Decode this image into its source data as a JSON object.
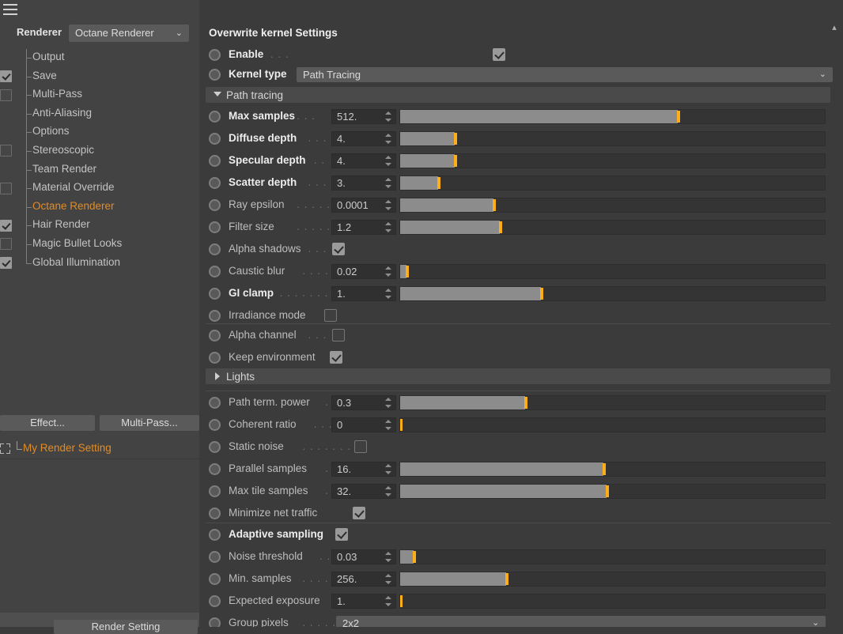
{
  "window": {
    "menu_icon": "hamburger-icon",
    "scroll_up_icon": "chevron-up-icon"
  },
  "sidebar": {
    "renderer_label": "Renderer",
    "renderer_value": "Octane Renderer",
    "renderer_chevron": "⌄",
    "tree_items": [
      {
        "label": "Output",
        "checkbox": "none",
        "selected": false
      },
      {
        "label": "Save",
        "checkbox": "on",
        "selected": false
      },
      {
        "label": "Multi-Pass",
        "checkbox": "off",
        "selected": false
      },
      {
        "label": "Anti-Aliasing",
        "checkbox": "none",
        "selected": false
      },
      {
        "label": "Options",
        "checkbox": "none",
        "selected": false
      },
      {
        "label": "Stereoscopic",
        "checkbox": "off",
        "selected": false
      },
      {
        "label": "Team Render",
        "checkbox": "none",
        "selected": false
      },
      {
        "label": "Material Override",
        "checkbox": "off",
        "selected": false
      },
      {
        "label": "Octane Renderer",
        "checkbox": "none",
        "selected": true
      },
      {
        "label": "Hair Render",
        "checkbox": "on",
        "selected": false
      },
      {
        "label": "Magic Bullet Looks",
        "checkbox": "off",
        "selected": false
      },
      {
        "label": "Global Illumination",
        "checkbox": "on",
        "selected": false
      }
    ],
    "effect_button": "Effect...",
    "multipass_button": "Multi-Pass...",
    "render_setting_name": "My Render Setting",
    "render_setting_button": "Render Setting"
  },
  "main": {
    "title": "Overwrite kernel Settings",
    "enable": {
      "label": "Enable",
      "dots": ". . .",
      "checked": true
    },
    "kernel_type": {
      "label": "Kernel type",
      "value": "Path Tracing",
      "chevron": "⌄"
    },
    "group_path_tracing": {
      "label": "Path tracing",
      "expanded": true
    },
    "group_lights": {
      "label": "Lights",
      "expanded": false
    },
    "rows": [
      {
        "label": "Max samples",
        "dots": ". . .",
        "bold": true,
        "type": "number",
        "value": "512.",
        "fill_pct": 65.4,
        "section": 1
      },
      {
        "label": "Diffuse depth",
        "dots": ". . .",
        "bold": true,
        "type": "number",
        "value": "4.",
        "fill_pct": 12.9,
        "section": 1
      },
      {
        "label": "Specular depth",
        "dots": ". .",
        "bold": true,
        "type": "number",
        "value": "4.",
        "fill_pct": 12.9,
        "section": 1
      },
      {
        "label": "Scatter depth",
        "dots": ". . .",
        "bold": true,
        "type": "number",
        "value": "3.",
        "fill_pct": 9.0,
        "section": 1
      },
      {
        "label": "Ray epsilon",
        "dots": ". . . . .",
        "bold": false,
        "type": "number",
        "value": "0.0001",
        "fill_pct": 21.9,
        "section": 1
      },
      {
        "label": "Filter size",
        "dots": ". . . . . . .",
        "bold": false,
        "type": "number",
        "value": "1.2",
        "fill_pct": 23.5,
        "section": 1
      },
      {
        "label": "Alpha shadows",
        "dots": ". . .",
        "bold": false,
        "type": "check",
        "value": true,
        "section": 1
      },
      {
        "label": "Caustic blur",
        "dots": ". . . . .",
        "bold": false,
        "type": "number",
        "value": "0.02",
        "fill_pct": 1.4,
        "section": 1
      },
      {
        "label": "GI clamp",
        "dots": ". . . . . . .",
        "bold": true,
        "type": "number",
        "value": "1.",
        "fill_pct": 33.1,
        "section": 1
      },
      {
        "label": "Irradiance mode",
        "dots": "",
        "bold": false,
        "type": "check",
        "value": false,
        "section": 1
      },
      {
        "label": "Alpha channel",
        "dots": ". . .",
        "bold": false,
        "type": "check",
        "value": false,
        "section": 2
      },
      {
        "label": "Keep environment",
        "dots": "",
        "bold": false,
        "type": "check",
        "value": true,
        "section": 2
      },
      {
        "label": "Path term. power",
        "dots": ". .",
        "bold": false,
        "type": "number",
        "value": "0.3",
        "fill_pct": 29.4,
        "section": 3
      },
      {
        "label": "Coherent ratio",
        "dots": ". . . .",
        "bold": false,
        "type": "number",
        "value": "0",
        "fill_pct": 0.0,
        "section": 3
      },
      {
        "label": "Static noise",
        "dots": ". . . . . . .",
        "bold": false,
        "type": "check",
        "value": false,
        "section": 3
      },
      {
        "label": "Parallel samples",
        "dots": ". . .",
        "bold": false,
        "type": "number",
        "value": "16.",
        "fill_pct": 47.8,
        "section": 3
      },
      {
        "label": "Max tile samples",
        "dots": ". .",
        "bold": false,
        "type": "number",
        "value": "32.",
        "fill_pct": 48.6,
        "section": 3
      },
      {
        "label": "Minimize net traffic",
        "dots": "",
        "bold": false,
        "type": "check",
        "value": true,
        "section": 3
      },
      {
        "label": "Adaptive sampling",
        "dots": "",
        "bold": true,
        "type": "check",
        "value": true,
        "section": 4
      },
      {
        "label": "Noise threshold",
        "dots": ". . . .",
        "bold": false,
        "type": "number",
        "value": "0.03",
        "fill_pct": 3.2,
        "section": 4
      },
      {
        "label": "Min. samples",
        "dots": ". . . . . .",
        "bold": false,
        "type": "number",
        "value": "256.",
        "fill_pct": 24.9,
        "section": 4
      },
      {
        "label": "Expected exposure",
        "dots": "",
        "bold": false,
        "type": "number",
        "value": "1.",
        "fill_pct": 0.0,
        "section": 4
      },
      {
        "label": "Group pixels",
        "dots": ". . . . . .",
        "bold": false,
        "type": "combo",
        "value": "2x2",
        "chevron": "⌄",
        "section": 4
      }
    ]
  },
  "colors": {
    "accent": "#e08c28",
    "slider_handle": "#ffae1a",
    "panel_bg": "#3b3b3b",
    "sidebar_bg": "#434343"
  }
}
